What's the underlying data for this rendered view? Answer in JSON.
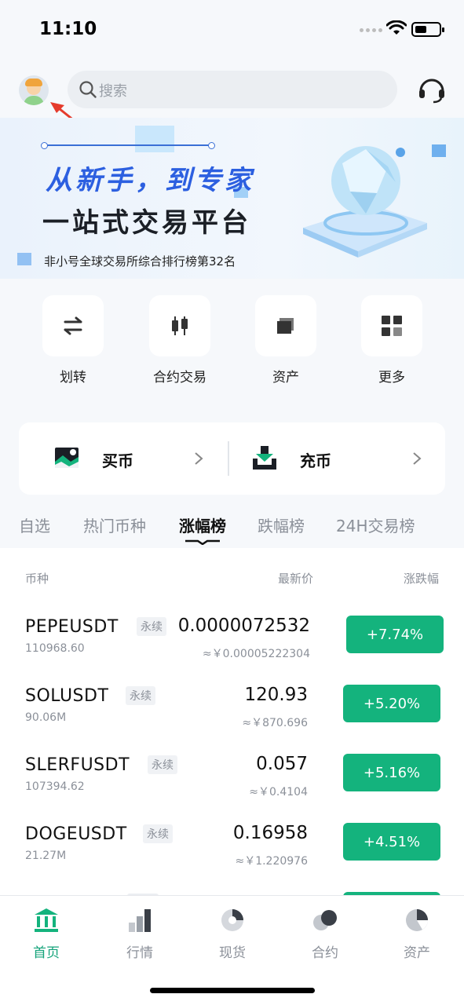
{
  "status_bar": {
    "time": "11:10"
  },
  "header": {
    "search_placeholder": "搜索"
  },
  "banner": {
    "title_line1": "从新手，到专家",
    "title_line2": "一站式交易平台",
    "subtitle": "非小号全球交易所综合排行榜第32名"
  },
  "quick_actions": [
    {
      "label": "划转",
      "icon": "transfer-icon"
    },
    {
      "label": "合约交易",
      "icon": "candlestick-icon"
    },
    {
      "label": "资产",
      "icon": "wallet-icon"
    },
    {
      "label": "更多",
      "icon": "grid-icon"
    }
  ],
  "buy_deposit": {
    "buy_label": "买币",
    "deposit_label": "充币"
  },
  "tabs": [
    "自选",
    "热门币种",
    "涨幅榜",
    "跌幅榜",
    "24H交易榜"
  ],
  "active_tab": "涨幅榜",
  "list_header": {
    "col_symbol": "币种",
    "col_price": "最新价",
    "col_change": "涨跌幅"
  },
  "rows": [
    {
      "symbol": "PEPEUSDT",
      "tag": "永续",
      "volume": "110968.60",
      "price": "0.0000072532",
      "cny": "≈￥0.00005222304",
      "change": "+7.74%"
    },
    {
      "symbol": "SOLUSDT",
      "tag": "永续",
      "volume": "90.06M",
      "price": "120.93",
      "cny": "≈￥870.696",
      "change": "+5.20%"
    },
    {
      "symbol": "SLERFUSDT",
      "tag": "永续",
      "volume": "107394.62",
      "price": "0.057",
      "cny": "≈￥0.4104",
      "change": "+5.16%"
    },
    {
      "symbol": "DOGEUSDT",
      "tag": "永续",
      "volume": "21.27M",
      "price": "0.16958",
      "cny": "≈￥1.220976",
      "change": "+4.51%"
    }
  ],
  "colors": {
    "accent": "#14b37d",
    "nav_active": "#14a37a",
    "banner_blue": "#2c5fe0"
  },
  "bottom_nav": [
    {
      "label": "首页",
      "icon": "home-icon",
      "active": true
    },
    {
      "label": "行情",
      "icon": "market-icon",
      "active": false
    },
    {
      "label": "现货",
      "icon": "spot-icon",
      "active": false
    },
    {
      "label": "合约",
      "icon": "futures-icon",
      "active": false
    },
    {
      "label": "资产",
      "icon": "assets-icon",
      "active": false
    }
  ]
}
